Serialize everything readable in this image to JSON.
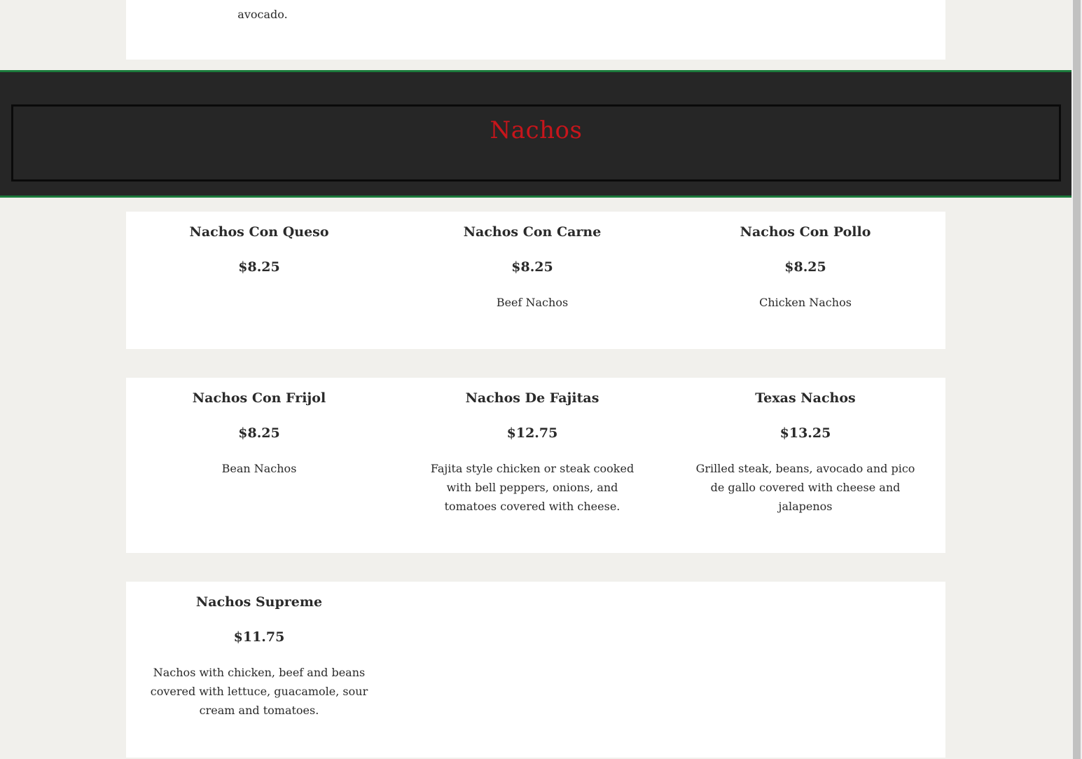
{
  "previous_section": {
    "desc_tail": "avocado."
  },
  "section": {
    "title": "Nachos"
  },
  "items": [
    {
      "name": "Nachos Con Queso",
      "price": "$8.25",
      "desc": ""
    },
    {
      "name": "Nachos Con Carne",
      "price": "$8.25",
      "desc": "Beef Nachos"
    },
    {
      "name": "Nachos Con Pollo",
      "price": "$8.25",
      "desc": "Chicken Nachos"
    },
    {
      "name": "Nachos Con Frijol",
      "price": "$8.25",
      "desc": "Bean Nachos"
    },
    {
      "name": "Nachos De Fajitas",
      "price": "$12.75",
      "desc": "Fajita style chicken or steak cooked with bell peppers, onions, and tomatoes covered with cheese."
    },
    {
      "name": "Texas Nachos",
      "price": "$13.25",
      "desc": "Grilled steak, beans, avocado and pico de gallo covered with cheese and jalapenos"
    },
    {
      "name": "Nachos Supreme",
      "price": "$11.75",
      "desc": "Nachos with chicken, beef and beans covered with lettuce, guacamole, sour cream and tomatoes."
    }
  ]
}
